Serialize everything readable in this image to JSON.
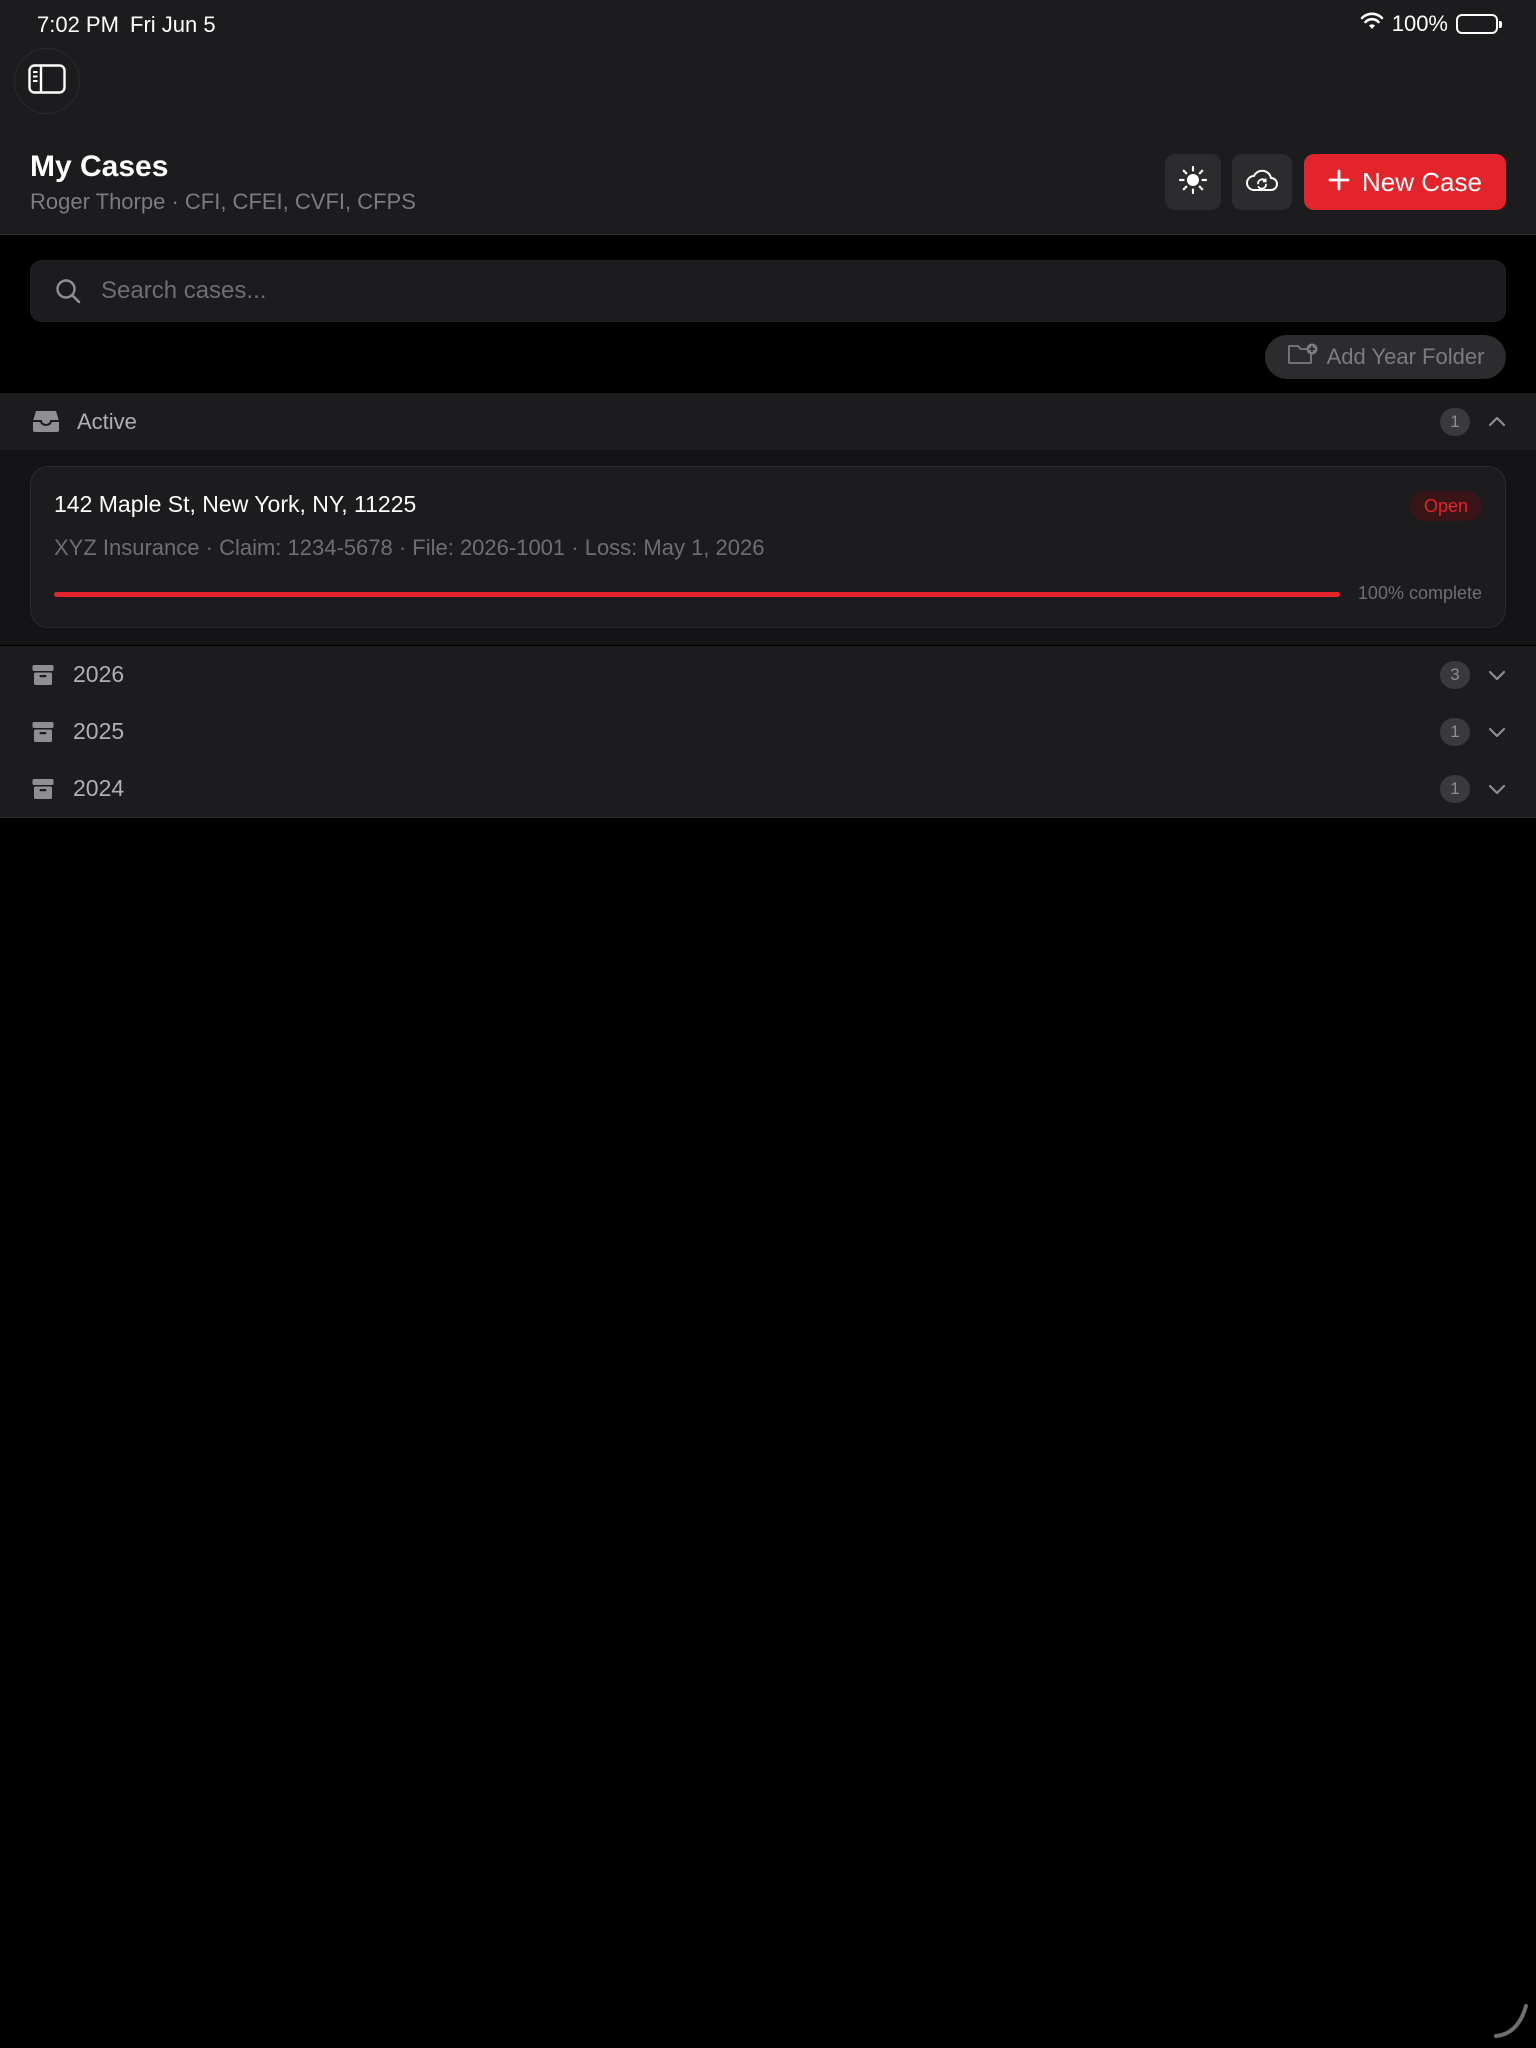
{
  "status_bar": {
    "time": "7:02 PM",
    "date": "Fri Jun 5",
    "battery": "100%"
  },
  "header": {
    "title": "My Cases",
    "subtitle": "Roger Thorpe · CFI, CFEI, CVFI, CFPS",
    "new_case_label": "New Case"
  },
  "search": {
    "placeholder": "Search cases..."
  },
  "add_year_folder_label": "Add Year Folder",
  "active_section": {
    "label": "Active",
    "count": "1",
    "expanded": true
  },
  "cases": [
    {
      "address": "142 Maple St, New York, NY, 11225",
      "status": "Open",
      "meta": "XYZ Insurance · Claim: 1234-5678 · File: 2026-1001 · Loss: May 1, 2026",
      "progress": 1.0,
      "progress_label": "100% complete"
    }
  ],
  "year_folders": [
    {
      "label": "2026",
      "count": "3"
    },
    {
      "label": "2025",
      "count": "1"
    },
    {
      "label": "2024",
      "count": "1"
    }
  ],
  "colors": {
    "accent": "#e3242b",
    "background": "#000000",
    "surface": "#1c1c1e"
  },
  "icons": {
    "sidebar_toggle": "sidebar-icon",
    "theme": "sun-icon",
    "sync": "cloud-sync-icon",
    "new_case": "plus-icon",
    "search": "search-icon",
    "add_year_folder": "folder-plus-icon",
    "active_section": "inbox-tray-icon",
    "year_folder": "archive-box-icon"
  }
}
